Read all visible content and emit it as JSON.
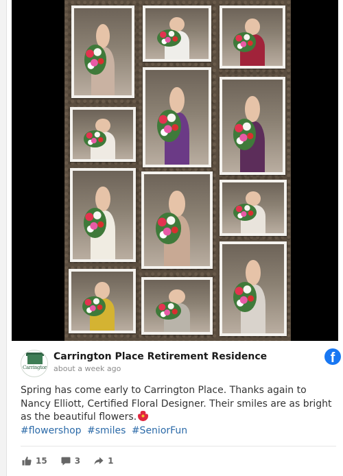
{
  "post": {
    "author": "Carrington Place Retirement Residence",
    "timestamp": "about a week ago",
    "avatar_text": "Carrington",
    "body_text": "Spring has come early to Carrington Place. Thanks again to Nancy Elliott, Certified Floral Designer. Their smiles are as bright as the beautiful flowers.",
    "hashtags": [
      "#flowershop",
      "#smiles",
      "#SeniorFun"
    ],
    "likes": "15",
    "comments": "3",
    "shares": "1"
  },
  "colors": {
    "facebook_blue": "#1877f2",
    "hashtag": "#2b6aa8",
    "brand_green": "#3e7d55"
  },
  "icons": {
    "platform": "facebook-icon",
    "emoji": "hibiscus-flower-icon",
    "like": "thumbs-up-icon",
    "comment": "comment-bubble-icon",
    "share": "share-arrow-icon"
  }
}
